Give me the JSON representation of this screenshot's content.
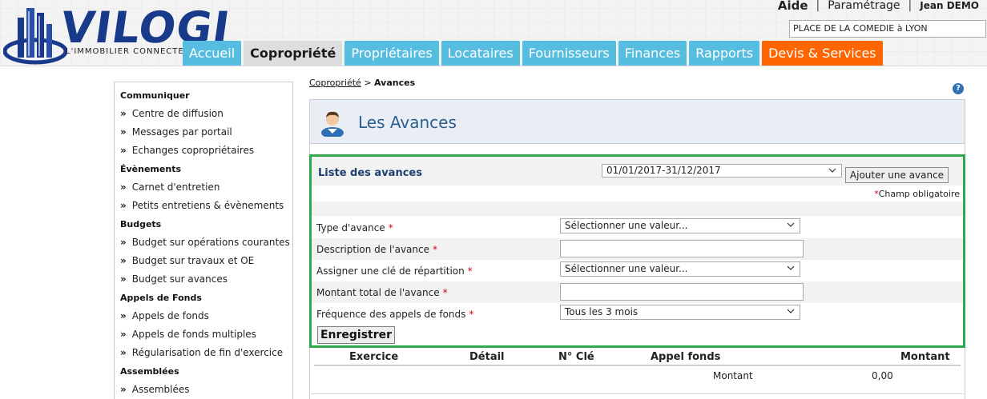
{
  "logo": {
    "word": "VILOGI",
    "tagline": "L'IMMOBILIER CONNECTÉ"
  },
  "top_links": {
    "help": "Aide",
    "settings": "Paramétrage",
    "user": "Jean DEMO"
  },
  "building": {
    "value": "PLACE DE LA COMEDIE à LYON"
  },
  "nav": {
    "tabs": [
      {
        "label": "Accueil"
      },
      {
        "label": "Copropriété"
      },
      {
        "label": "Propriétaires"
      },
      {
        "label": "Locataires"
      },
      {
        "label": "Fournisseurs"
      },
      {
        "label": "Finances"
      },
      {
        "label": "Rapports"
      },
      {
        "label": "Devis & Services"
      }
    ]
  },
  "sidebar": {
    "sections": [
      {
        "title": "Communiquer",
        "items": [
          "Centre de diffusion",
          "Messages par portail",
          "Echanges copropriétaires"
        ]
      },
      {
        "title": "Évènements",
        "items": [
          "Carnet d'entretien",
          "Petits entretiens & évènements"
        ]
      },
      {
        "title": "Budgets",
        "items": [
          "Budget sur opérations courantes",
          "Budget sur travaux et OE",
          "Budget sur avances"
        ]
      },
      {
        "title": "Appels de Fonds",
        "items": [
          "Appels de fonds",
          "Appels de fonds multiples",
          "Régularisation de fin d'exercice"
        ]
      },
      {
        "title": "Assemblées",
        "items": [
          "Assemblées"
        ]
      }
    ],
    "bullet": "»"
  },
  "breadcrumb": {
    "parent": "Copropriété",
    "separator": ">",
    "current": "Avances"
  },
  "help_icon": {
    "glyph": "?"
  },
  "panel": {
    "title": "Les Avances"
  },
  "list": {
    "title": "Liste des avances",
    "period": "01/01/2017-31/12/2017",
    "add_button": "Ajouter une avance",
    "required_star": "*",
    "required_note": "Champ obligatoire"
  },
  "form": {
    "fields": [
      {
        "label": "Type d'avance",
        "star": "*",
        "kind": "select",
        "value": "Sélectionner une valeur..."
      },
      {
        "label": "Description de l'avance",
        "star": "*",
        "kind": "input",
        "value": ""
      },
      {
        "label": "Assigner une clé de répartition",
        "star": "*",
        "kind": "select",
        "value": "Sélectionner une valeur..."
      },
      {
        "label": "Montant total de l'avance",
        "star": "*",
        "kind": "input",
        "value": ""
      },
      {
        "label": "Fréquence des appels de fonds",
        "star": "*",
        "kind": "select",
        "value": "Tous les 3 mois"
      }
    ],
    "save_button": "Enregistrer"
  },
  "table": {
    "headers": [
      "Exercice",
      "Détail",
      "N° Clé",
      "Appel fonds",
      "Montant"
    ],
    "row": {
      "label": "Montant",
      "value": "0,00"
    }
  },
  "colors": {
    "tab": "#56bde0",
    "tab_active": "#dddddd",
    "tab_orange": "#ff6600",
    "highlight_border": "#2eaa48",
    "required": "#d0021b",
    "title_blue": "#2e5e8e"
  }
}
